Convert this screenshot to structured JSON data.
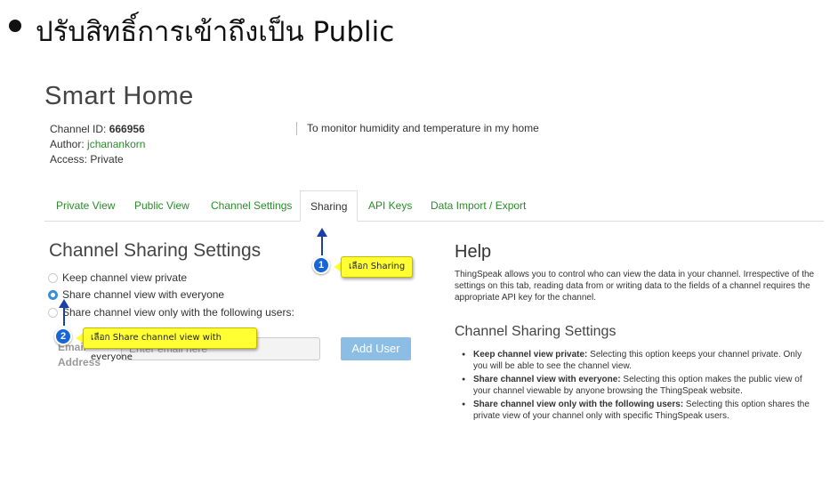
{
  "slide": {
    "title": "ปรับสิทธิ์การเข้าถึงเป็น Public"
  },
  "channel": {
    "name": "Smart Home",
    "id_label": "Channel ID: ",
    "id_value": "666956",
    "author_label": "Author: ",
    "author_value": "jchanankorn",
    "access_label": "Access: ",
    "access_value": "Private",
    "description": "To monitor humidity and temperature in my home"
  },
  "tabs": [
    {
      "label": "Private View"
    },
    {
      "label": "Public View"
    },
    {
      "label": "Channel Settings"
    },
    {
      "label": "Sharing",
      "active": true
    },
    {
      "label": "API Keys"
    },
    {
      "label": "Data Import / Export"
    }
  ],
  "sharing": {
    "title": "Channel Sharing Settings",
    "options": [
      {
        "label": "Keep channel view private",
        "checked": false
      },
      {
        "label": "Share channel view with everyone",
        "checked": true
      },
      {
        "label": "Share channel view only with the following users:",
        "checked": false
      }
    ],
    "email_label_line1": "Email",
    "email_label_line2": "Address",
    "email_placeholder": "Enter email here",
    "add_user_label": "Add User"
  },
  "help": {
    "title": "Help",
    "paragraph": "ThingSpeak allows you to control who can view the data in your channel. Irrespective of the settings on this tab, reading data from or writing data to the fields of a channel requires the appropriate API key for the channel.",
    "subtitle": "Channel Sharing Settings",
    "items": [
      {
        "bold": "Keep channel view private:",
        "text": " Selecting this option keeps your channel private. Only you will be able to see the channel view."
      },
      {
        "bold": "Share channel view with everyone:",
        "text": " Selecting this option makes the public view of your channel viewable by anyone browsing the ThingSpeak website."
      },
      {
        "bold": "Share channel view only with the following users:",
        "text": " Selecting this option shares the private view of your channel only with specific ThingSpeak users."
      }
    ]
  },
  "annotations": [
    {
      "number": "1",
      "text": "เลือก Sharing"
    },
    {
      "number": "2",
      "text": "เลือก Share channel view with everyone"
    }
  ],
  "colors": {
    "link": "#2a8c2a",
    "button": "#8cbde4",
    "callout": "#ffff33",
    "marker": "#1666d6"
  }
}
